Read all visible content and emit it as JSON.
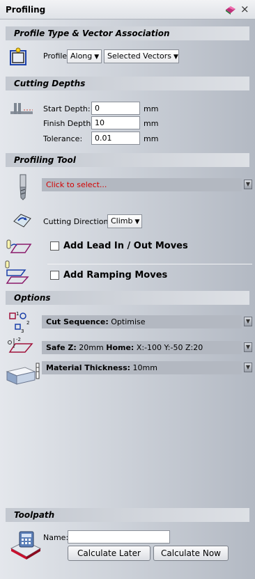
{
  "panel": {
    "title": "Profiling"
  },
  "sections": {
    "profile_type": "Profile Type & Vector Association",
    "cutting_depths": "Cutting Depths",
    "profiling_tool": "Profiling Tool",
    "options": "Options",
    "toolpath": "Toolpath"
  },
  "profile": {
    "label": "Profile",
    "side_value": "Along",
    "selection_value": "Selected Vectors"
  },
  "depths": {
    "start_label": "Start Depth:",
    "start_value": "0",
    "finish_label": "Finish Depth:",
    "finish_value": "10",
    "tolerance_label": "Tolerance:",
    "tolerance_value": "0.01",
    "unit": "mm"
  },
  "tool": {
    "select_text": "Click to select...",
    "direction_label": "Cutting Direction:",
    "direction_value": "Climb",
    "lead_label": "Add Lead In / Out Moves",
    "ramp_label": "Add Ramping Moves"
  },
  "options": {
    "cut_sequence_label": "Cut Sequence:",
    "cut_sequence_value": "Optimise",
    "safez_label": "Safe Z:",
    "safez_value": "20mm",
    "home_label": "Home:",
    "home_value": "X:-100 Y:-50 Z:20",
    "thickness_label": "Material Thickness:",
    "thickness_value": "10mm"
  },
  "toolpath": {
    "name_label": "Name:",
    "name_value": "",
    "calc_later": "Calculate Later",
    "calc_now": "Calculate Now"
  },
  "colors": {
    "select_text": "#d40000",
    "accent_blue": "#1a3fa8"
  },
  "icons": [
    "pin-icon",
    "close-icon",
    "profile-vector-icon",
    "cutting-depth-icon",
    "tool-bit-icon",
    "cutting-direction-icon",
    "lead-in-icon",
    "ramping-icon",
    "cut-sequence-icon",
    "safe-z-icon",
    "material-thickness-icon",
    "toolpath-calculator-icon",
    "expand-icon"
  ]
}
